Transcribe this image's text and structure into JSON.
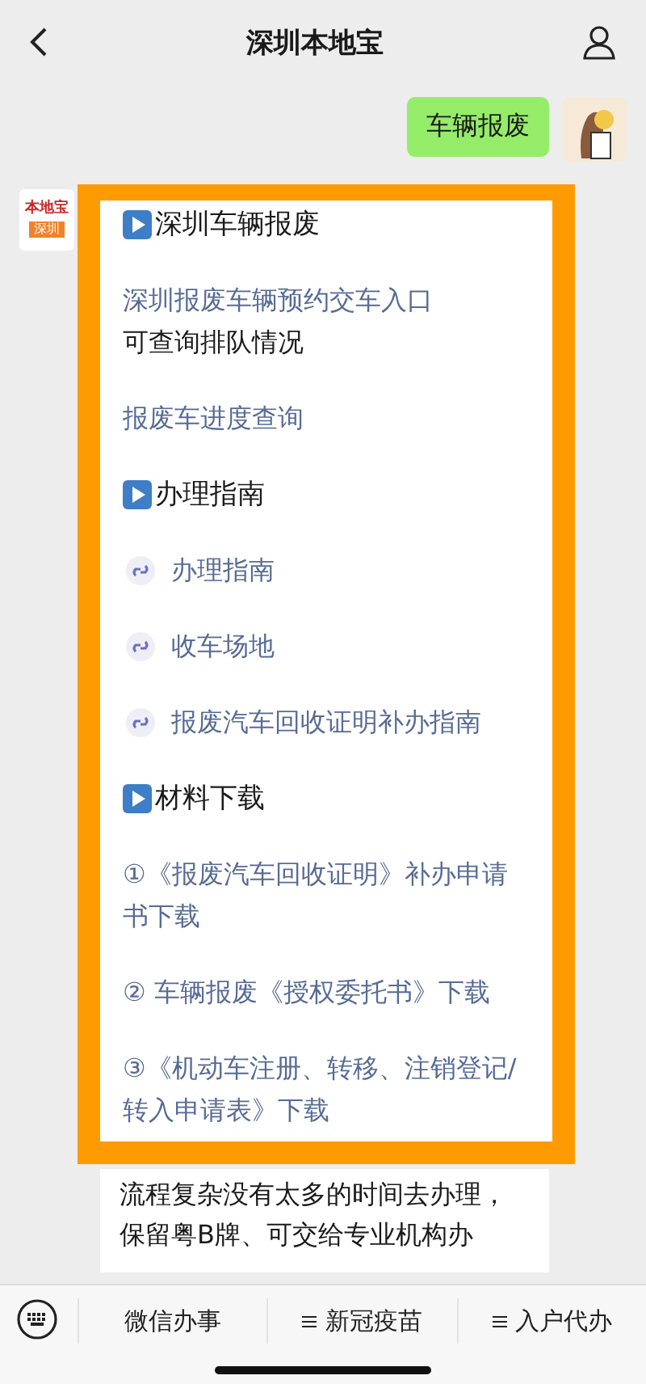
{
  "header": {
    "title": "深圳本地宝"
  },
  "sent_message": {
    "text": "车辆报废"
  },
  "sender_logo": {
    "title": "本地宝",
    "badge": "深圳"
  },
  "reply_card": {
    "blocks": [
      {
        "kind": "heading",
        "text": "深圳车辆报废"
      },
      {
        "kind": "link",
        "text": "深圳报废车辆预约交车入口"
      },
      {
        "kind": "text",
        "text": "可查询排队情况"
      },
      {
        "kind": "link",
        "text": "报废车进度查询"
      },
      {
        "kind": "heading",
        "text": "办理指南"
      },
      {
        "kind": "mini",
        "text": "办理指南"
      },
      {
        "kind": "mini",
        "text": "收车场地"
      },
      {
        "kind": "mini",
        "text": "报废汽车回收证明补办指南"
      },
      {
        "kind": "heading",
        "text": "材料下载"
      },
      {
        "kind": "link",
        "text": "①《报废汽车回收证明》补办申请书下载"
      },
      {
        "kind": "link",
        "text": "② 车辆报废《授权委托书》下载"
      },
      {
        "kind": "link",
        "text": "③《机动车注册、转移、注销登记/转入申请表》下载"
      }
    ]
  },
  "next_message": {
    "text": "流程复杂没有太多的时间去办理，保留粤B牌、可交给专业机构办"
  },
  "bottom_menu": {
    "items": [
      {
        "label": "微信办事",
        "has_menu": false
      },
      {
        "label": "新冠疫苗",
        "has_menu": true
      },
      {
        "label": "入户代办",
        "has_menu": true
      }
    ]
  }
}
